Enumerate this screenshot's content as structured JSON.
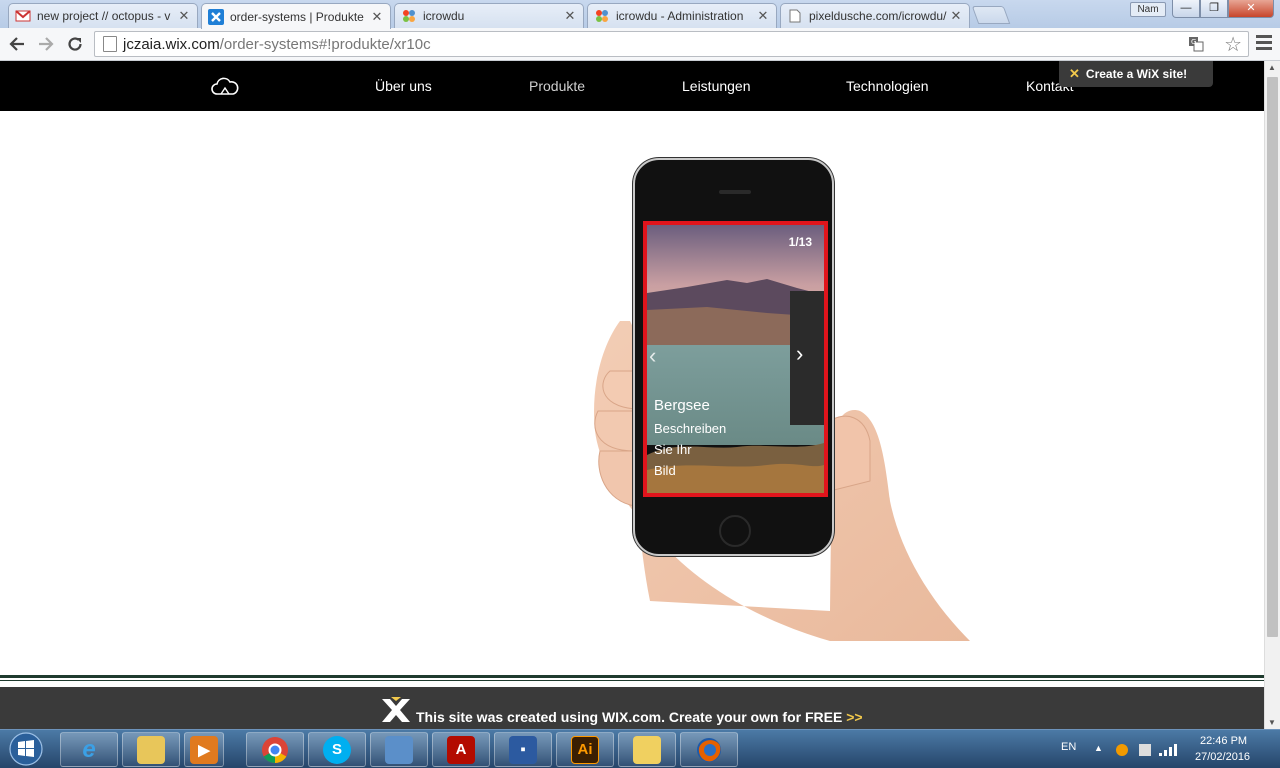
{
  "browser": {
    "tabs": [
      {
        "title": "new project // octopus - v",
        "favicon": "gmail-icon",
        "active": false
      },
      {
        "title": "order-systems | Produkte",
        "favicon": "wix-icon",
        "active": true
      },
      {
        "title": "icrowdu",
        "favicon": "joomla-icon",
        "active": false
      },
      {
        "title": "icrowdu - Administration",
        "favicon": "joomla-icon",
        "active": false
      },
      {
        "title": "pixeldusche.com/icrowdu/",
        "favicon": "page-icon",
        "active": false
      }
    ],
    "user_chip": "Nam",
    "url_host": "jczaia.wix.com",
    "url_path": "/order-systems#!produkte/xr10c"
  },
  "site": {
    "nav": [
      "Über uns",
      "Produkte",
      "Leistungen",
      "Technologien",
      "Kontakt"
    ],
    "current_nav": "Produkte",
    "wix_create": "Create a WiX site!",
    "slide": {
      "counter": "1/13",
      "title": "Bergsee",
      "desc": [
        "Beschreiben",
        "Sie Ihr",
        "Bild"
      ]
    },
    "footer": {
      "text": "This site was created using WIX.com. Create your own for FREE",
      "arrows": ">>"
    }
  },
  "taskbar": {
    "apps": [
      "internet-explorer-icon",
      "file-explorer-icon",
      "media-player-icon",
      "chrome-icon",
      "skype-icon",
      "window-icon",
      "acrobat-icon",
      "save-icon",
      "illustrator-icon",
      "paint-icon",
      "firefox-icon"
    ],
    "illustrator_label": "Ai",
    "lang": "EN",
    "time": "22:46 PM",
    "date": "27/02/2016"
  },
  "colors": {
    "highlight": "#e0141c",
    "nav_bg": "#000000",
    "footer_bg": "#3a3a3a",
    "wix_yellow": "#f2c94c"
  }
}
